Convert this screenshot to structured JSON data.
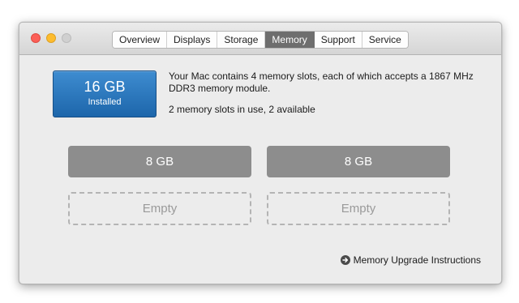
{
  "tabs": [
    {
      "label": "Overview",
      "active": false
    },
    {
      "label": "Displays",
      "active": false
    },
    {
      "label": "Storage",
      "active": false
    },
    {
      "label": "Memory",
      "active": true
    },
    {
      "label": "Support",
      "active": false
    },
    {
      "label": "Service",
      "active": false
    }
  ],
  "installed": {
    "size": "16 GB",
    "label": "Installed"
  },
  "info": {
    "line1": "Your Mac contains 4 memory slots, each of which accepts a 1867 MHz DDR3 memory module.",
    "line2": "2 memory slots in use, 2 available"
  },
  "slots": [
    {
      "label": "8 GB",
      "state": "filled"
    },
    {
      "label": "8 GB",
      "state": "filled"
    },
    {
      "label": "Empty",
      "state": "empty"
    },
    {
      "label": "Empty",
      "state": "empty"
    }
  ],
  "link": {
    "label": "Memory Upgrade Instructions",
    "icon": "arrow-circle-right-icon"
  },
  "colors": {
    "active_tab": "#6e6e6e",
    "installed_blue": "#2a78c0",
    "slot_filled": "#8d8d8d"
  }
}
